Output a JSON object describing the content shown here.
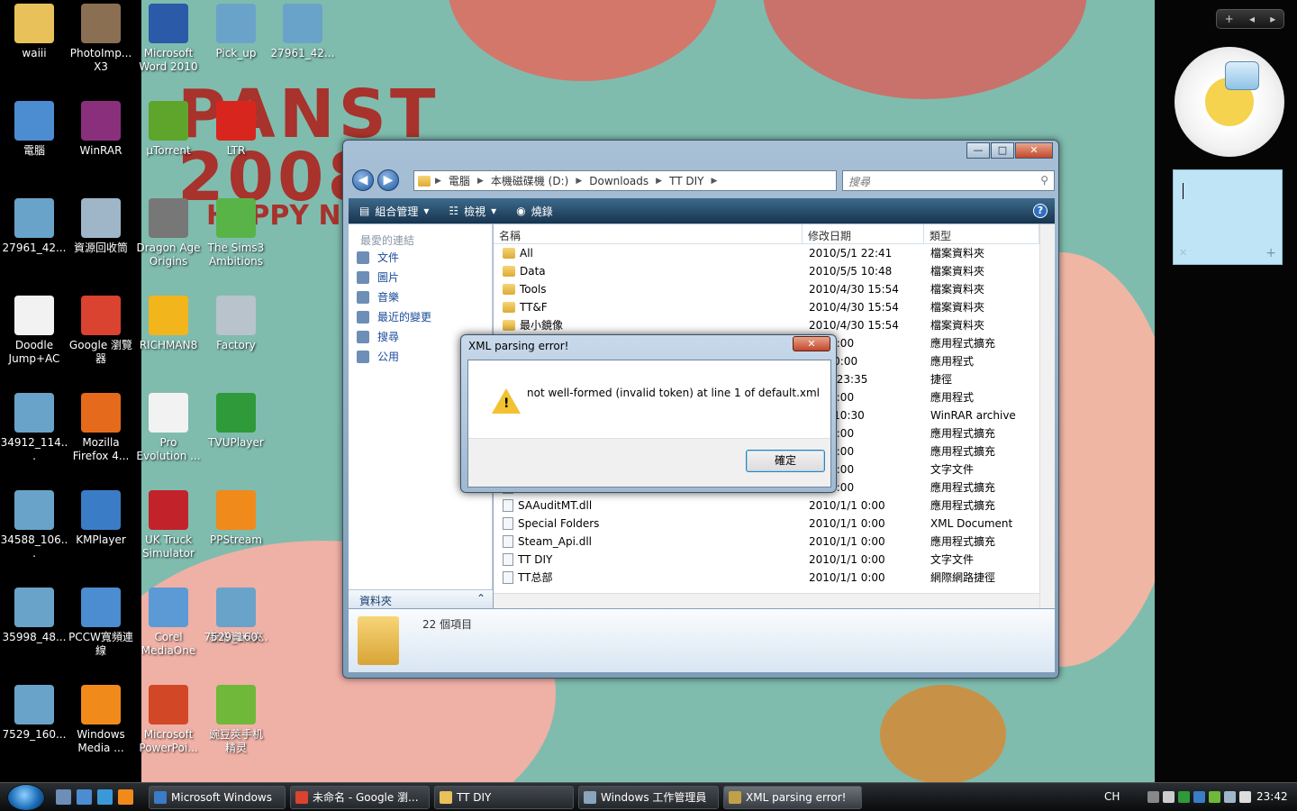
{
  "desktop": {
    "icons": [
      {
        "label": "waiii",
        "icon": "folder-icon",
        "color": "#e8c15a"
      },
      {
        "label": "PhotoImp...\nX3",
        "icon": "photoimpact-icon",
        "color": "#8b6f52"
      },
      {
        "label": "Microsoft\nWord 2010",
        "icon": "word-icon",
        "color": "#2a5aa8"
      },
      {
        "label": "Pick_up",
        "icon": "image-file-icon",
        "color": "#6aa3c9"
      },
      {
        "label": "27961_42...",
        "icon": "image-file-icon",
        "color": "#6aa3c9"
      },
      {
        "label": "電腦",
        "icon": "computer-icon",
        "color": "#4c8cd0"
      },
      {
        "label": "WinRAR",
        "icon": "winrar-icon",
        "color": "#8a2f7c"
      },
      {
        "label": "µTorrent",
        "icon": "utorrent-icon",
        "color": "#5fa52c"
      },
      {
        "label": "LTR",
        "icon": "pdf-icon",
        "color": "#d8261e"
      },
      {
        "label": "27961_42...",
        "icon": "image-file-icon",
        "color": "#6aa3c9"
      },
      {
        "label": "資源回收筒",
        "icon": "recycle-bin-icon",
        "color": "#9fb6c9"
      },
      {
        "label": "Dragon Age\nOrigins",
        "icon": "dragon-age-icon",
        "color": "#777777"
      },
      {
        "label": "The Sims3\nAmbitions",
        "icon": "sims-icon",
        "color": "#58b447"
      },
      {
        "label": "Doodle\nJump+AC",
        "icon": "text-file-icon",
        "color": "#f2f2f2"
      },
      {
        "label": "Google 瀏覽\n器",
        "icon": "chrome-icon",
        "color": "#d9432f"
      },
      {
        "label": "RICHMAN8",
        "icon": "richman-icon",
        "color": "#f2b51c"
      },
      {
        "label": "Factory",
        "icon": "factory-icon",
        "color": "#b9c3cc"
      },
      {
        "label": "34912_114...",
        "icon": "image-file-icon",
        "color": "#6aa3c9"
      },
      {
        "label": "Mozilla\nFirefox 4...",
        "icon": "firefox-icon",
        "color": "#e56a1c"
      },
      {
        "label": "Pro\nEvolution ...",
        "icon": "pes-icon",
        "color": "#f2f2f2"
      },
      {
        "label": "TVUPlayer",
        "icon": "tvu-icon",
        "color": "#2f9a3a"
      },
      {
        "label": "34588_106...",
        "icon": "image-file-icon",
        "color": "#6aa3c9"
      },
      {
        "label": "KMPlayer",
        "icon": "kmplayer-icon",
        "color": "#3a7cc6"
      },
      {
        "label": "UK Truck\nSimulator",
        "icon": "truck-icon",
        "color": "#c2232b"
      },
      {
        "label": "PPStream",
        "icon": "ppstream-icon",
        "color": "#f08a1b"
      },
      {
        "label": "35998_48...",
        "icon": "image-file-icon",
        "color": "#6aa3c9"
      },
      {
        "label": "PCCW寬頻連\n線",
        "icon": "network-icon",
        "color": "#4c8cd0"
      },
      {
        "label": "Corel\nMediaOne",
        "icon": "corel-icon",
        "color": "#5c9ad5"
      },
      {
        "label": "新增資料夾",
        "icon": "folder-icon",
        "color": "#e8c15a"
      },
      {
        "label": "7529_160...",
        "icon": "image-file-icon",
        "color": "#6aa3c9"
      },
      {
        "label": "Windows\nMedia ...",
        "icon": "media-player-icon",
        "color": "#f08a1b"
      },
      {
        "label": "Microsoft\nPowerPoi...",
        "icon": "powerpoint-icon",
        "color": "#d24726"
      },
      {
        "label": "豌豆莢手机\n精灵",
        "icon": "wandoujia-icon",
        "color": "#6fb83a"
      },
      {
        "label": "7529_160...",
        "icon": "image-file-icon",
        "color": "#6aa3c9"
      }
    ],
    "wallpaper_text": {
      "line1": "PANST",
      "line2": "2008",
      "line3": "HAPPY NE"
    }
  },
  "explorer": {
    "address": [
      "電腦",
      "本機磁碟機 (D:)",
      "Downloads",
      "TT DIY"
    ],
    "search_placeholder": "搜尋",
    "toolbar": {
      "organize": "組合管理",
      "views": "檢視",
      "burn": "燒錄",
      "help": "?"
    },
    "nav": {
      "heading": "最愛的連結",
      "links": [
        "文件",
        "圖片",
        "音樂",
        "最近的變更",
        "搜尋",
        "公用"
      ],
      "folders_label": "資料夾"
    },
    "columns": [
      "名稱",
      "修改日期",
      "類型"
    ],
    "rows": [
      {
        "name": "All",
        "date": "2010/5/1 22:41",
        "type": "檔案資料夾",
        "kind": "folder"
      },
      {
        "name": "Data",
        "date": "2010/5/5 10:48",
        "type": "檔案資料夾",
        "kind": "folder"
      },
      {
        "name": "Tools",
        "date": "2010/4/30 15:54",
        "type": "檔案資料夾",
        "kind": "folder"
      },
      {
        "name": "TT&F",
        "date": "2010/4/30 15:54",
        "type": "檔案資料夾",
        "kind": "folder"
      },
      {
        "name": "最小鏡像",
        "date": "2010/4/30 15:54",
        "type": "檔案資料夾",
        "kind": "folder"
      },
      {
        "name": "",
        "date": "1/1 0:00",
        "type": "應用程式擴充",
        "kind": "file"
      },
      {
        "name": "",
        "date": "/3/1 0:00",
        "type": "應用程式",
        "kind": "file"
      },
      {
        "name": "",
        "date": "7/20 23:35",
        "type": "捷徑",
        "kind": "file"
      },
      {
        "name": "",
        "date": "1/1 0:00",
        "type": "應用程式",
        "kind": "file"
      },
      {
        "name": "",
        "date": "/3/1 10:30",
        "type": "WinRAR archive",
        "kind": "file"
      },
      {
        "name": "",
        "date": "1/1 0:00",
        "type": "應用程式擴充",
        "kind": "file"
      },
      {
        "name": "",
        "date": "1/1 0:00",
        "type": "應用程式擴充",
        "kind": "file"
      },
      {
        "name": "",
        "date": "1/1 0:00",
        "type": "文字文件",
        "kind": "file"
      },
      {
        "name": "",
        "date": "1/1 0:00",
        "type": "應用程式擴充",
        "kind": "file"
      },
      {
        "name": "SAAuditMT.dll",
        "date": "2010/1/1 0:00",
        "type": "應用程式擴充",
        "kind": "file"
      },
      {
        "name": "Special Folders",
        "date": "2010/1/1 0:00",
        "type": "XML Document",
        "kind": "file"
      },
      {
        "name": "Steam_Api.dll",
        "date": "2010/1/1 0:00",
        "type": "應用程式擴充",
        "kind": "file"
      },
      {
        "name": "TT DIY",
        "date": "2010/1/1 0:00",
        "type": "文字文件",
        "kind": "file"
      },
      {
        "name": "TT总部",
        "date": "2010/1/1 0:00",
        "type": "網際網路捷徑",
        "kind": "file"
      }
    ],
    "status": "22 個項目"
  },
  "dialog": {
    "title": "XML parsing error!",
    "message": "not well-formed (invalid token) at line 1 of default.xml",
    "ok": "確定",
    "close": "✕"
  },
  "taskbar": {
    "tasks": [
      {
        "label": "Microsoft Windows",
        "color": "#3a7cc6"
      },
      {
        "label": "未命名 - Google 瀏...",
        "color": "#d9432f"
      },
      {
        "label": "TT DIY",
        "color": "#e8c15a"
      },
      {
        "label": "Windows 工作管理員",
        "color": "#8aa4bd"
      },
      {
        "label": "XML parsing error!",
        "color": "#c0a14a"
      }
    ],
    "lang": "CH",
    "time": "23:42"
  },
  "colors": {
    "accent": "#1a4b9b",
    "wallpaper": "#7fbcae"
  }
}
